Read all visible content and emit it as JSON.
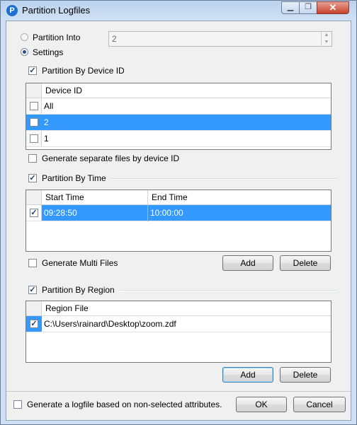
{
  "window": {
    "title": "Partition Logfiles",
    "app_icon": "P",
    "close_glyph": "✕",
    "min_glyph": "▁",
    "max_glyph": "❐"
  },
  "partition_into": {
    "label": "Partition Into",
    "value": "2",
    "selected": false
  },
  "settings": {
    "label": "Settings",
    "selected": true
  },
  "device": {
    "checkbox_label": "Partition By Device ID",
    "checked": true,
    "column": "Device ID",
    "rows": [
      {
        "label": "All",
        "checked": false,
        "selected": false
      },
      {
        "label": "2",
        "checked": false,
        "selected": true
      },
      {
        "label": "1",
        "checked": false,
        "selected": false
      }
    ],
    "separate_files_label": "Generate separate files by device ID",
    "separate_files_checked": false
  },
  "time": {
    "checkbox_label": "Partition By Time",
    "checked": true,
    "columns": [
      "Start Time",
      "End Time"
    ],
    "rows": [
      {
        "start": "09:28:50",
        "end": "10:00:00",
        "checked": true,
        "selected": true
      }
    ],
    "multi_files_label": "Generate Multi Files",
    "multi_files_checked": false,
    "add_label": "Add",
    "delete_label": "Delete"
  },
  "region": {
    "checkbox_label": "Partition By Region",
    "checked": true,
    "column": "Region File",
    "rows": [
      {
        "path": "C:\\Users\\rainard\\Desktop\\zoom.zdf",
        "checked": true
      }
    ],
    "add_label": "Add",
    "delete_label": "Delete"
  },
  "footer": {
    "nonselected_label": "Generate a logfile based on non-selected attributes.",
    "nonselected_checked": false,
    "ok_label": "OK",
    "cancel_label": "Cancel"
  },
  "check_glyph": "✓"
}
